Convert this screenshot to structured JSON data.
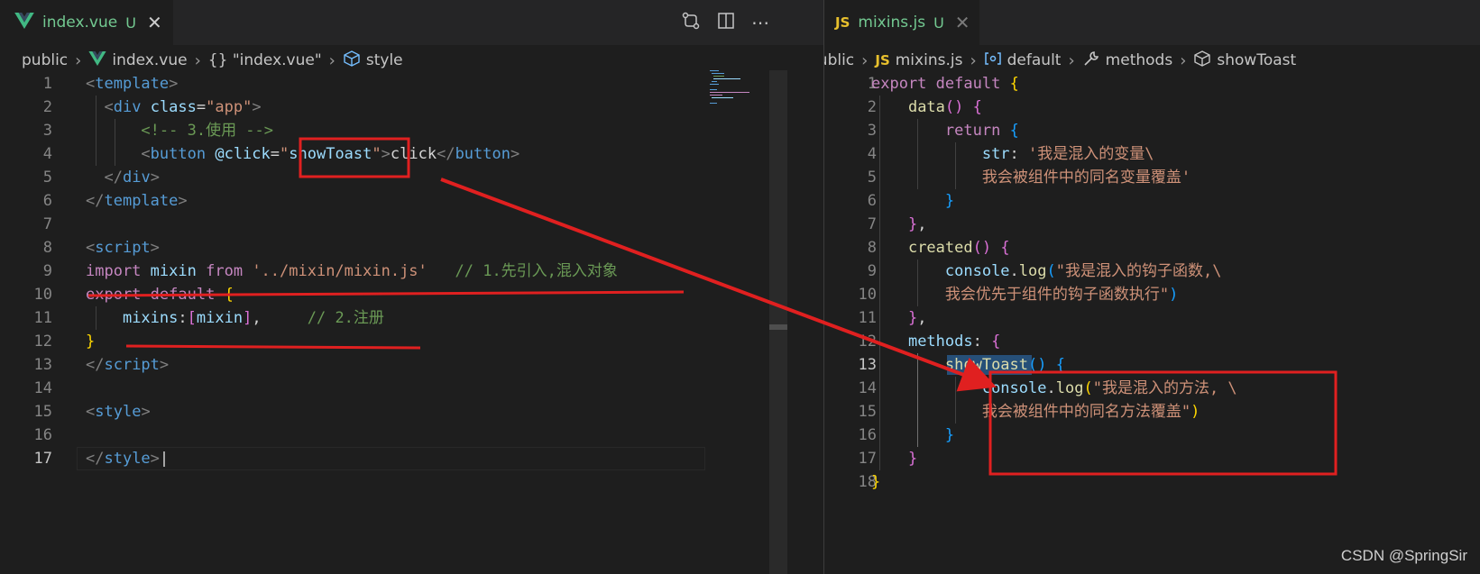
{
  "left": {
    "tab": {
      "label": "index.vue",
      "status": "U",
      "close": "✕"
    },
    "actions": {
      "compare": "⇄",
      "split": "▯",
      "more": "⋯"
    },
    "breadcrumb": [
      "public",
      "index.vue",
      "{} \"index.vue\"",
      "style"
    ],
    "line_numbers": [
      "1",
      "2",
      "3",
      "4",
      "5",
      "6",
      "7",
      "8",
      "9",
      "10",
      "11",
      "12",
      "13",
      "14",
      "15",
      "16",
      "17"
    ],
    "active_line": "17"
  },
  "right": {
    "tab": {
      "label": "mixins.js",
      "status": "U",
      "close": "✕",
      "icon": "JS"
    },
    "breadcrumb": [
      "public",
      "mixins.js",
      "default",
      "methods",
      "showToast"
    ],
    "line_numbers": [
      "1",
      "2",
      "3",
      "4",
      "5",
      "6",
      "7",
      "8",
      "9",
      "10",
      "11",
      "12",
      "13",
      "14",
      "15",
      "16",
      "17",
      "18"
    ],
    "active_line": "13"
  },
  "watermark": "CSDN @SpringSir",
  "colors": {
    "annotation": "#e02020",
    "modified": "#73c991",
    "background": "#1e1e1e"
  },
  "icons": [
    "vue-icon",
    "js-icon",
    "compare-changes-icon",
    "split-editor-icon",
    "more-actions-icon",
    "close-icon",
    "style-symbol-icon",
    "object-symbol-icon",
    "wrench-icon",
    "method-cube-icon",
    "chevron-right-icon"
  ]
}
